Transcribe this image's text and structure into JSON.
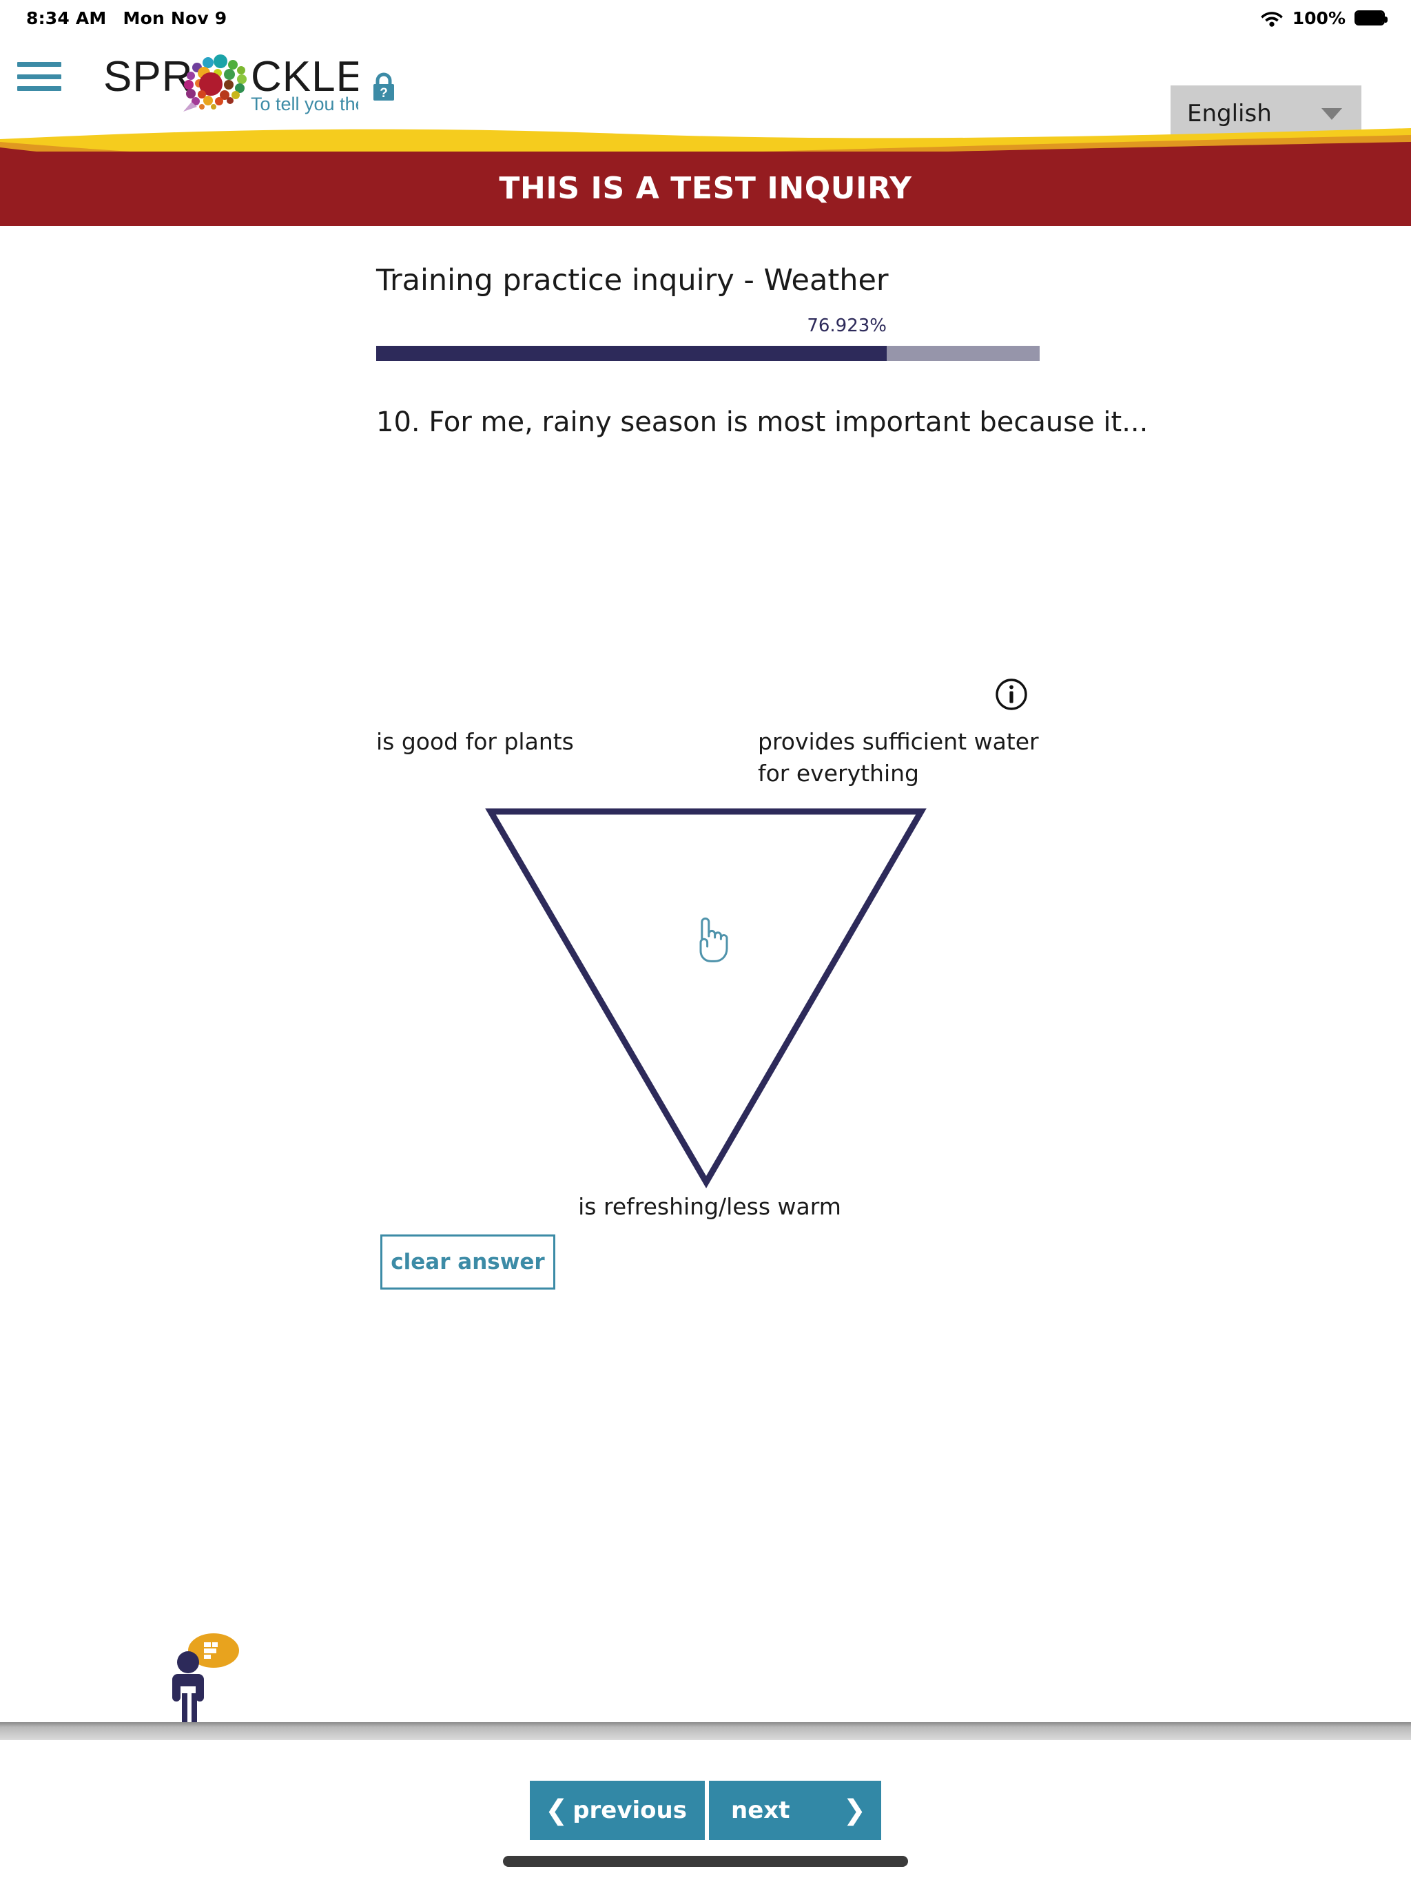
{
  "statusbar": {
    "time": "8:34 AM",
    "date": "Mon Nov 9",
    "battery_pct": "100%",
    "wifi_icon": "wifi-icon",
    "battery_icon": "battery-full-icon"
  },
  "header": {
    "menu_icon": "hamburger-menu-icon",
    "logo_text": "SPROCKLER",
    "logo_tagline": "To tell you the truth...",
    "help_lock_icon": "lock-question-icon",
    "language": {
      "selected": "English",
      "caret_icon": "chevron-down-icon"
    }
  },
  "banner": {
    "title": "THIS IS A TEST INQUIRY",
    "bg_color": "#951c20",
    "wave_color": "#f5cc1e",
    "wave_accent_color": "#e8951e"
  },
  "inquiry": {
    "title": "Training practice inquiry - Weather",
    "progress": {
      "percent_label": "76.923%",
      "percent_value": 76.923,
      "fill_color": "#2d2a5a",
      "track_color": "#9695aa"
    },
    "question": {
      "number": "10.",
      "text": "10. For me, rainy season is most important because it...",
      "info_icon": "info-circle-icon"
    },
    "triad": {
      "corner_top_left": "is good for plants",
      "corner_top_right": "provides sufficient water for everything",
      "corner_bottom": "is refreshing/less warm",
      "stroke_color": "#2d2a5a",
      "cursor_icon": "pointing-hand-cursor"
    },
    "clear_answer_label": "clear answer",
    "accent_color": "#3c8ba6"
  },
  "avatar": {
    "icon": "person-with-speech-bubble-icon",
    "body_color": "#2d2a5a",
    "bubble_color": "#e8a31e"
  },
  "bottom_nav": {
    "previous_label": "previous",
    "previous_icon": "chevron-left-icon",
    "next_label": "next",
    "next_icon": "chevron-right-icon",
    "button_color": "#3288a6"
  }
}
